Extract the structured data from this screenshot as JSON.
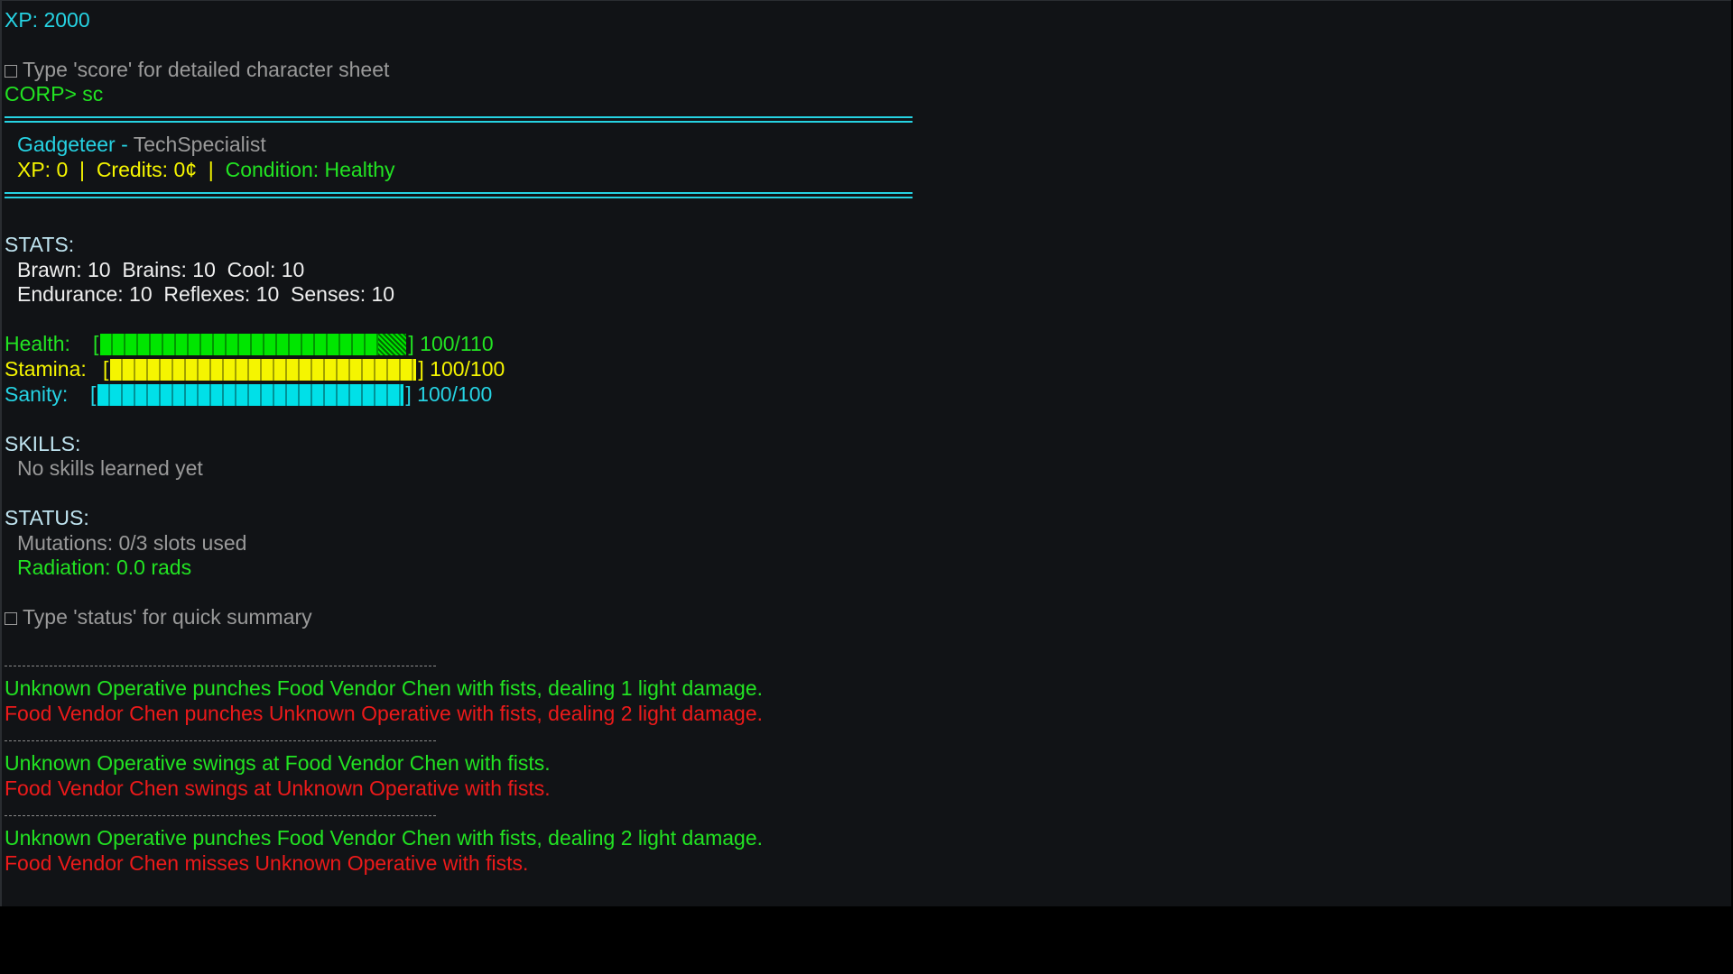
{
  "header": {
    "xp_line": "XP: 2000",
    "hint_score": "Type 'score' for detailed character sheet",
    "prompt": "CORP> sc"
  },
  "character": {
    "name": "Gadgeteer",
    "separator": " - ",
    "class": "TechSpecialist",
    "xp": "XP: 0",
    "sep1": "  |  ",
    "credits": "Credits: 0¢",
    "sep2": "  |  ",
    "condition": "Condition: Healthy"
  },
  "stats": {
    "heading": "STATS:",
    "row1": "Brawn: 10  Brains: 10  Cool: 10",
    "row2": "Endurance: 10  Reflexes: 10  Senses: 10"
  },
  "bars": [
    {
      "label": "Health:",
      "value_text": "100/110",
      "current": 100,
      "max": 110,
      "color": "#00e600"
    },
    {
      "label": "Stamina:",
      "value_text": "100/100",
      "current": 100,
      "max": 100,
      "color": "#f5f500"
    },
    {
      "label": "Sanity:",
      "value_text": "100/100",
      "current": 100,
      "max": 100,
      "color": "#00e0e8"
    }
  ],
  "skills": {
    "heading": "SKILLS:",
    "text": "No skills learned yet"
  },
  "status": {
    "heading": "STATUS:",
    "mutations": "Mutations: 0/3 slots used",
    "radiation": "Radiation: 0.0 rads",
    "hint": "Type 'status' for quick summary"
  },
  "combat_log": [
    [
      {
        "side": "player",
        "text": "Unknown Operative punches Food Vendor Chen with fists, dealing 1 light damage."
      },
      {
        "side": "enemy",
        "text": "Food Vendor Chen punches Unknown Operative with fists, dealing 2 light damage."
      }
    ],
    [
      {
        "side": "player",
        "text": "Unknown Operative swings at Food Vendor Chen with fists."
      },
      {
        "side": "enemy",
        "text": "Food Vendor Chen swings at Unknown Operative with fists."
      }
    ],
    [
      {
        "side": "player",
        "text": "Unknown Operative punches Food Vendor Chen with fists, dealing 2 light damage."
      },
      {
        "side": "enemy",
        "text": "Food Vendor Chen misses Unknown Operative with fists."
      }
    ]
  ],
  "colors": {
    "background": "#111316",
    "cyan": "#26d3e3",
    "green": "#22e322",
    "yellow": "#f5f500",
    "red": "#ec1a1a",
    "grey": "#9a9a9a"
  }
}
